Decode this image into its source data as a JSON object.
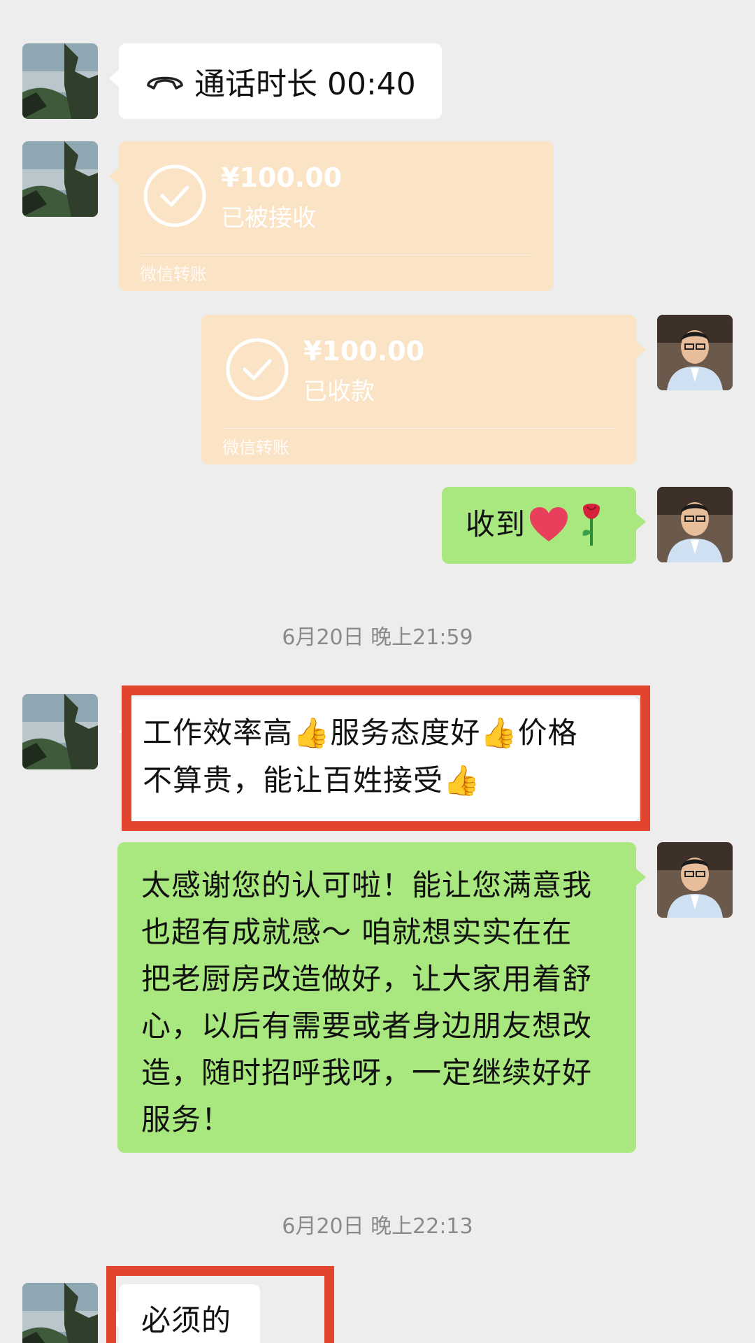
{
  "messages": {
    "call": {
      "icon": "phone-hangup-icon",
      "text": "通话时长 00:40"
    },
    "transfer_received": {
      "amount": "¥100.00",
      "status": "已被接收",
      "label": "微信转账",
      "icon": "check-circle-icon"
    },
    "transfer_sent": {
      "amount": "¥100.00",
      "status": "已收款",
      "label": "微信转账",
      "icon": "check-circle-icon"
    },
    "reply_received": {
      "text": "收到",
      "emoji_icons": [
        "heart-icon",
        "rose-icon"
      ]
    },
    "timestamp_1": "6月20日 晚上21:59",
    "review": {
      "line1_parts": [
        "工作效率高",
        "服务态度好",
        "价格"
      ],
      "line2_parts": [
        "不算贵，能让百姓接受"
      ],
      "emoji_icon": "thumbs-up-icon"
    },
    "thanks": {
      "lines": [
        "太感谢您的认可啦！能让您满意我",
        "也超有成就感～ 咱就想实实在在",
        "把老厨房改造做好，让大家用着舒",
        "心，以后有需要或者身边朋友想改",
        "造，随时招呼我呀，一定继续好好",
        "服务！"
      ]
    },
    "timestamp_2": "6月20日 晚上22:13",
    "last": {
      "text": "必须的"
    }
  },
  "colors": {
    "background": "#ededed",
    "incoming_bubble": "#ffffff",
    "outgoing_bubble": "#a9e87e",
    "transfer_bubble": "#fbe3c6",
    "highlight": "#e2452e"
  }
}
